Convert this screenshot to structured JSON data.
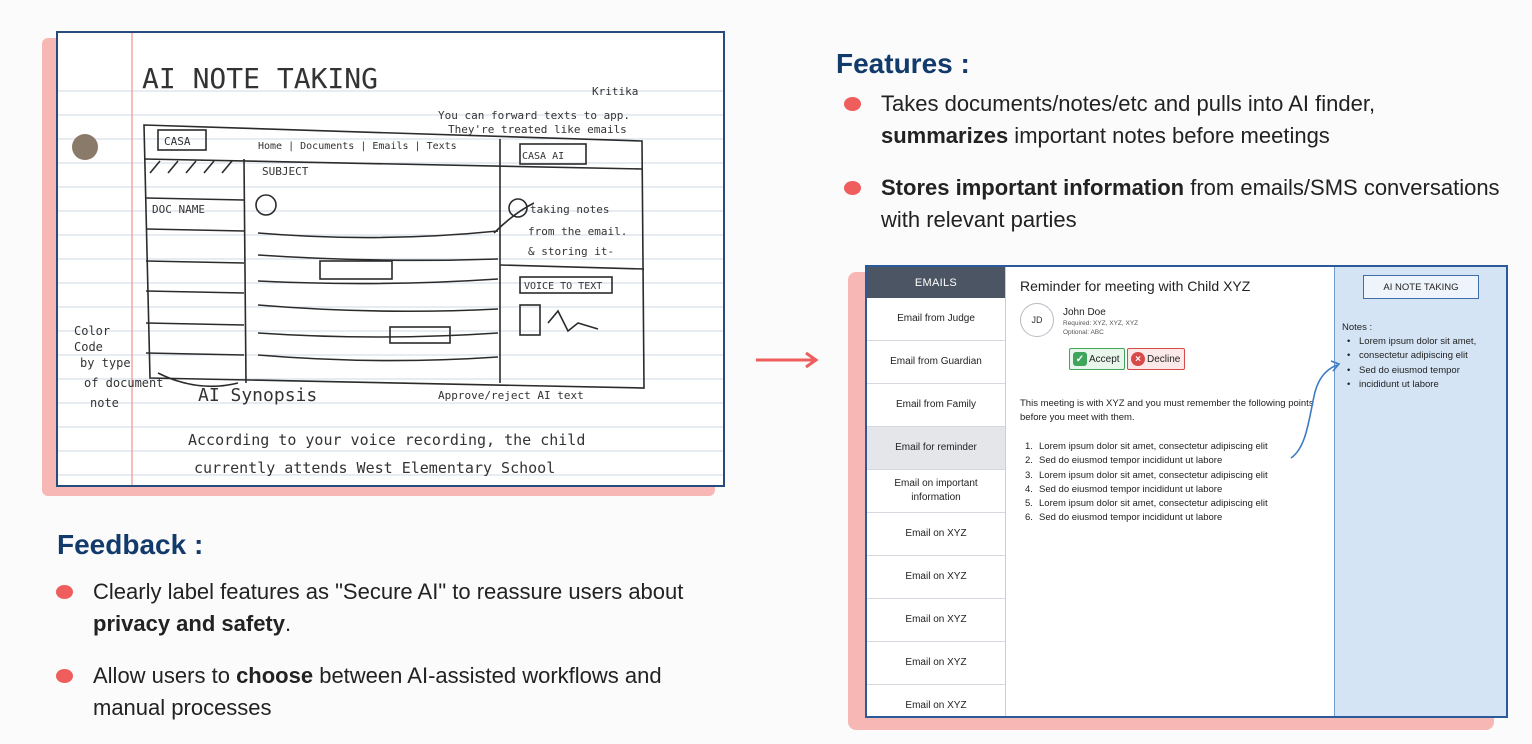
{
  "sketch": {
    "title": "AI NOTE TAKING",
    "author": "Kritika",
    "forward_note_1": "You can forward texts to app.",
    "forward_note_2": "They're treated like emails",
    "logo": "CASA",
    "nav": "Home | Documents | Emails | Texts",
    "panel_title": "CASA AI",
    "subject": "SUBJECT",
    "doc_name": "DOC NAME",
    "ai_note_1": "taking notes",
    "ai_note_2": "from the email.",
    "ai_note_3": "& storing it-",
    "voice": "VOICE TO TEXT",
    "side_note_1": "Color",
    "side_note_2": "Code",
    "side_note_3": "by type",
    "side_note_4": "of document",
    "side_note_5": "note",
    "approve_note": "Approve/reject AI text",
    "synopsis": "AI Synopsis",
    "synopsis_line_1": "According to your voice recording, the child",
    "synopsis_line_2": "currently attends West Elementary School"
  },
  "features": {
    "title": "Features :",
    "bullet_1_pre": "Takes documents/notes/etc and pulls into AI finder, ",
    "bullet_1_bold": "summarizes",
    "bullet_1_post": " important notes before meetings",
    "bullet_2_bold": "Stores important information",
    "bullet_2_post": " from emails/SMS conversations with relevant parties"
  },
  "feedback": {
    "title": "Feedback :",
    "bullet_1_pre": "Clearly label features as \"Secure AI\" to reassure users about ",
    "bullet_1_bold": "privacy and safety",
    "bullet_1_post": ".",
    "bullet_2_pre": "Allow users to ",
    "bullet_2_bold": "choose",
    "bullet_2_post": " between AI-assisted workflows and manual processes"
  },
  "email_ui": {
    "sidebar_header": "EMAILS",
    "sidebar_items": [
      "Email from Judge",
      "Email from Guardian",
      "Email from Family",
      "Email for reminder",
      "Email on important information",
      "Email on XYZ",
      "Email on XYZ",
      "Email on XYZ",
      "Email on XYZ",
      "Email on XYZ"
    ],
    "active_index": 3,
    "message_title": "Reminder for meeting with Child XYZ",
    "avatar_initials": "JD",
    "sender_name": "John Doe",
    "required": "Required: XYZ, XYZ, XYZ",
    "optional": "Optional: ABC",
    "accept_label": "Accept",
    "decline_label": "Decline",
    "body": "This meeting is with XYZ and you must remember the following points before you meet with them.",
    "points": [
      "Lorem ipsum dolor sit amet, consectetur adipiscing elit",
      "Sed do eiusmod tempor incididunt ut labore",
      "Lorem ipsum dolor sit amet, consectetur adipiscing elit",
      "Sed do eiusmod tempor incididunt ut labore",
      "Lorem ipsum dolor sit amet, consectetur adipiscing elit",
      "Sed do eiusmod tempor incididunt ut labore"
    ],
    "ai_button": "AI NOTE TAKING",
    "notes_label": "Notes :",
    "notes": [
      "Lorem ipsum dolor sit amet,",
      "consectetur adipiscing elit",
      "Sed do eiusmod tempor",
      "incididunt ut labore"
    ]
  },
  "colors": {
    "heading": "#123a6b",
    "bullet": "#ef5d5d",
    "shadow": "#f7b7b5",
    "frame": "#2a5a9a",
    "arrow": "#ef5d5d",
    "panel": "#d4e4f5"
  }
}
